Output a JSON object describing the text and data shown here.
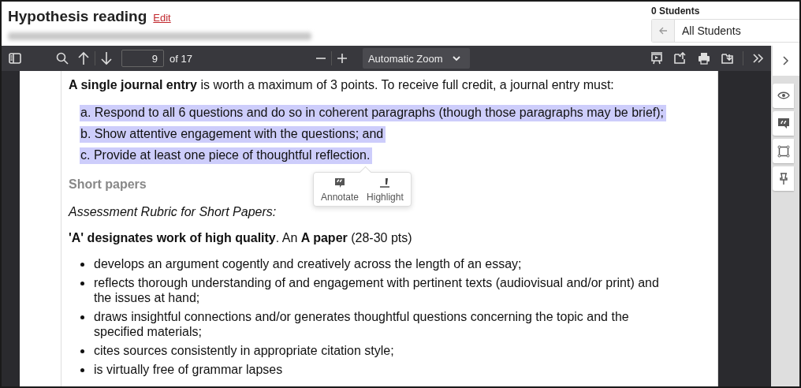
{
  "header": {
    "title": "Hypothesis reading",
    "edit_link": "Edit",
    "students_count": "0 Students",
    "student_filter": "All Students"
  },
  "toolbar": {
    "page_number": "9",
    "page_count": "of 17",
    "zoom": "Automatic Zoom"
  },
  "document": {
    "intro": "**A single journal entry** is worth a maximum of 3 points. To receive full credit, a journal entry must:",
    "requirements": [
      {
        "text": "a. Respond to all 6 questions and do so in coherent paragraphs (though those paragraphs may be brief);",
        "highlighted": true
      },
      {
        "text": "b. Show attentive engagement with the questions; and",
        "highlighted": true
      },
      {
        "text": "c. Provide at least one piece of thoughtful reflection.",
        "highlighted": true
      }
    ],
    "heading": "Short papers",
    "rubric_title": "Assessment Rubric for Short Papers:",
    "grade_line": "**'A' designates work of high quality**. An **A paper** (28-30 pts)",
    "bullets": [
      "develops an argument cogently and creatively across the length of an essay;",
      "reflects thorough understanding of and engagement with pertinent texts (audiovisual and/or print) and the issues at hand;",
      "draws insightful connections and/or generates thoughtful questions concerning the topic and the specified materials;",
      "cites sources consistently in appropriate citation style;",
      "is virtually free of grammar lapses"
    ]
  },
  "adder": {
    "buttons": [
      {
        "kind": "annotate",
        "label": "Annotate"
      },
      {
        "kind": "highlight",
        "label": "Highlight"
      }
    ]
  }
}
